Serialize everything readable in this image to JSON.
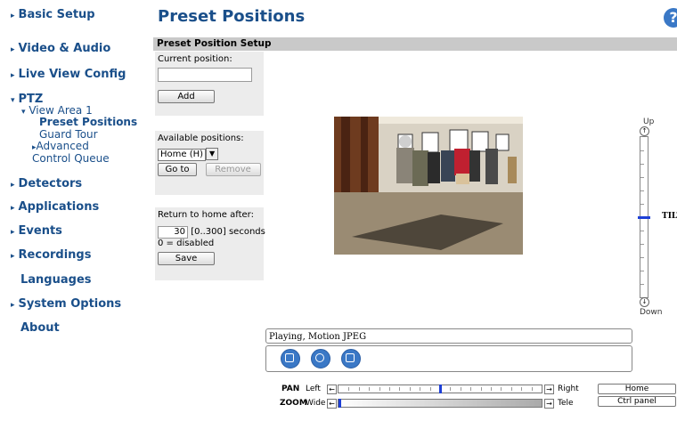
{
  "sidebar": {
    "items": [
      {
        "label": "Basic Setup"
      },
      {
        "label": "Video & Audio"
      },
      {
        "label": "Live View Config"
      },
      {
        "label": "PTZ"
      },
      {
        "label": "Detectors"
      },
      {
        "label": "Applications"
      },
      {
        "label": "Events"
      },
      {
        "label": "Recordings"
      },
      {
        "label": "Languages"
      },
      {
        "label": "System Options"
      },
      {
        "label": "About"
      }
    ],
    "ptz_sub": {
      "view_area": "View Area 1",
      "preset_positions": "Preset Positions",
      "guard_tour": "Guard Tour",
      "advanced": "Advanced",
      "control_queue": "Control Queue"
    }
  },
  "header": {
    "title": "Preset Positions",
    "help": "?"
  },
  "section": {
    "title": "Preset Position Setup"
  },
  "current_position": {
    "label": "Current position:",
    "value": "",
    "add_label": "Add"
  },
  "available": {
    "label": "Available positions:",
    "selected": "Home (H)",
    "goto_label": "Go to",
    "remove_label": "Remove"
  },
  "return_home": {
    "label": "Return to home after:",
    "value": "30",
    "range": "[0..300] seconds,",
    "note": "0 = disabled",
    "save_label": "Save"
  },
  "tilt": {
    "up": "Up",
    "down": "Down",
    "label": "TILT",
    "level": 0.5
  },
  "status": {
    "text": "Playing, Motion JPEG"
  },
  "pan": {
    "label": "PAN",
    "left": "Left",
    "right": "Right",
    "level": 0.5
  },
  "zoom": {
    "label": "ZOOM",
    "wide": "Wide",
    "tele": "Tele",
    "level": 0.0
  },
  "side_buttons": {
    "home": "Home",
    "ctrl_panel": "Ctrl panel"
  }
}
